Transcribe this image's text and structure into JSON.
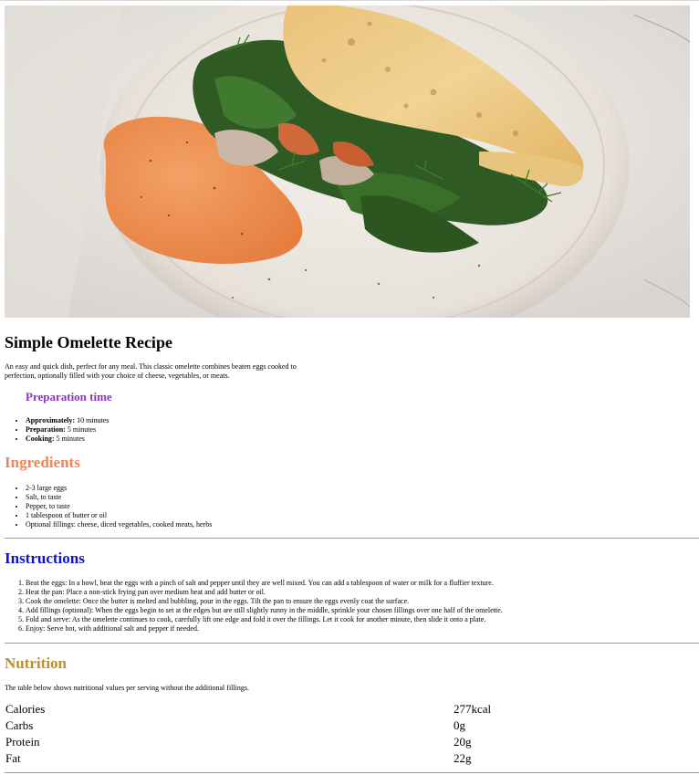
{
  "hero": {
    "image": "omelette-plate-photo"
  },
  "recipe": {
    "title": "Simple Omelette Recipe",
    "description": "An easy and quick dish, perfect for any meal. This classic omelette combines beaten eggs cooked to perfection, optionally filled with your choice of cheese, vegetables, or meats."
  },
  "preparation": {
    "heading": "Preparation time",
    "items": [
      {
        "label": "Approximately:",
        "value": "10 minutes"
      },
      {
        "label": "Preparation:",
        "value": "5 minutes"
      },
      {
        "label": "Cooking:",
        "value": "5 minutes"
      }
    ]
  },
  "ingredients": {
    "heading": "Ingredients",
    "items": [
      "2-3 large eggs",
      "Salt, to taste",
      "Pepper, to taste",
      "1 tablespoon of butter or oil",
      "Optional fillings: cheese, diced vegetables, cooked meats, herbs"
    ]
  },
  "instructions": {
    "heading": "Instructions",
    "steps": [
      "Beat the eggs: In a bowl, beat the eggs with a pinch of salt and pepper until they are well mixed. You can add a tablespoon of water or milk for a fluffier texture.",
      "Heat the pan: Place a non-stick frying pan over medium heat and add butter or oil.",
      "Cook the omelette: Once the butter is melted and bubbling, pour in the eggs. Tilt the pan to ensure the eggs evenly coat the surface.",
      "Add fillings (optional): When the eggs begin to set at the edges but are still slightly runny in the middle, sprinkle your chosen fillings over one half of the omelette.",
      "Fold and serve: As the omelette continues to cook, carefully lift one edge and fold it over the fillings. Let it cook for another minute, then slide it onto a plate.",
      "Enjoy: Serve hot, with additional salt and pepper if needed."
    ]
  },
  "nutrition": {
    "heading": "Nutrition",
    "description": "The table below shows nutritional values per serving without the additional fillings.",
    "rows": [
      {
        "name": "Calories",
        "value": "277kcal"
      },
      {
        "name": "Carbs",
        "value": "0g"
      },
      {
        "name": "Protein",
        "value": "20g"
      },
      {
        "name": "Fat",
        "value": "22g"
      }
    ]
  },
  "colors": {
    "preparation_heading": "#8a34c6",
    "ingredients_heading": "#f0855a",
    "instructions_heading": "#1111cc",
    "nutrition_heading": "#b8912e"
  }
}
